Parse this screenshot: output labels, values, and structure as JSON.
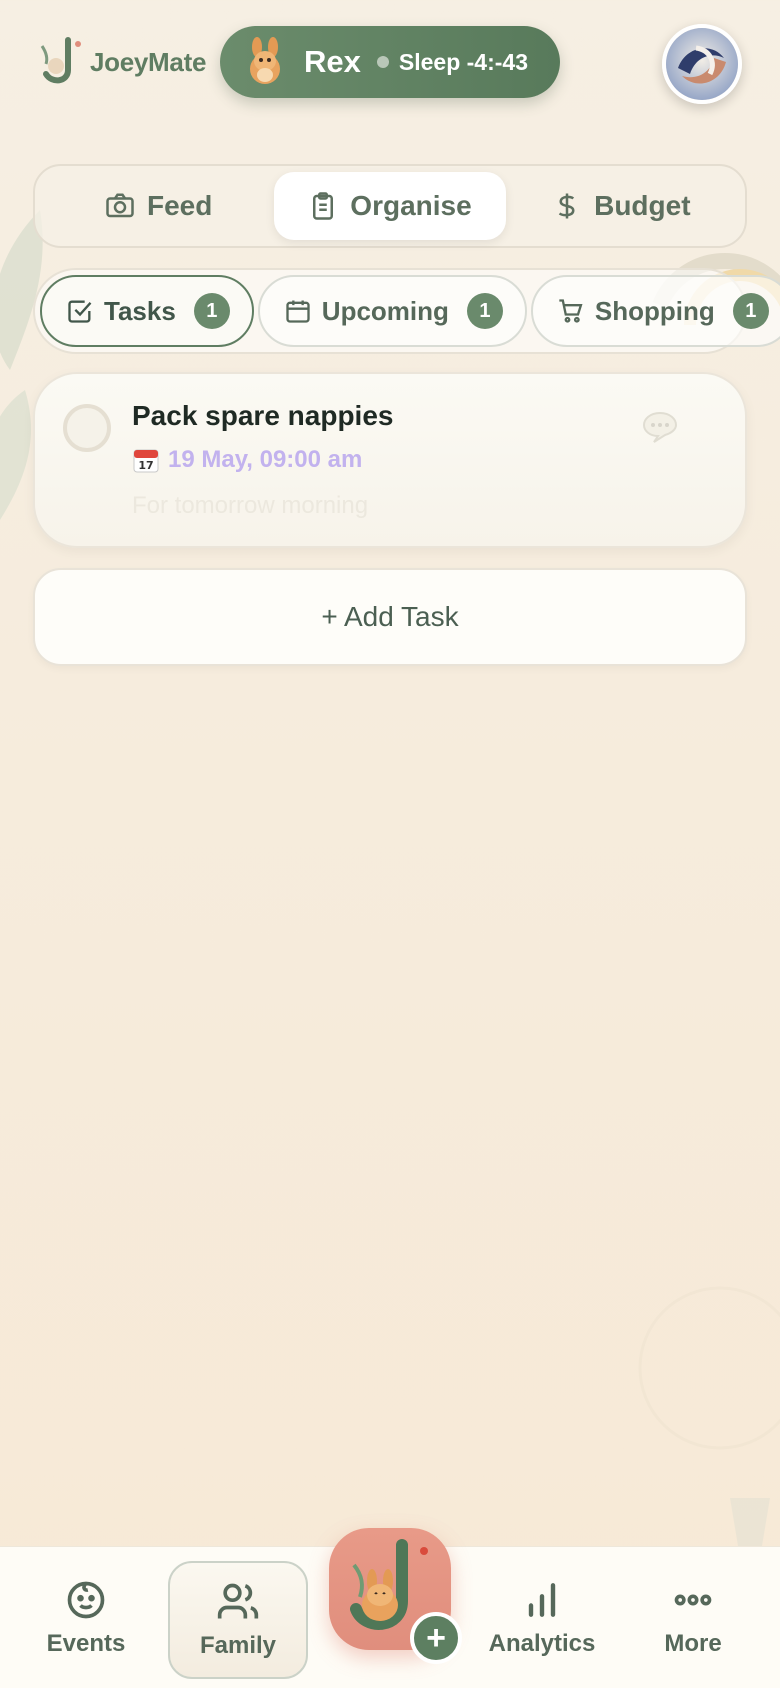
{
  "app": {
    "name": "JoeyMate"
  },
  "baby": {
    "name": "Rex",
    "status": "Sleep -4:-43"
  },
  "main_tabs": [
    {
      "label": "Feed",
      "icon": "camera-icon"
    },
    {
      "label": "Organise",
      "icon": "clipboard-icon",
      "active": true
    },
    {
      "label": "Budget",
      "icon": "dollar-icon"
    }
  ],
  "sub_tabs": [
    {
      "label": "Tasks",
      "count": "1",
      "icon": "checkbox-icon",
      "active": true
    },
    {
      "label": "Upcoming",
      "count": "1",
      "icon": "calendar-icon"
    },
    {
      "label": "Shopping",
      "count": "1",
      "icon": "cart-icon"
    }
  ],
  "tasks": [
    {
      "title": "Pack spare nappies",
      "date": "19 May, 09:00 am",
      "note": "For tomorrow morning"
    }
  ],
  "add_task_label": "+ Add Task",
  "bottom_nav": [
    {
      "label": "Events",
      "icon": "baby-face-icon"
    },
    {
      "label": "Family",
      "icon": "users-icon",
      "active": true
    },
    {
      "label": "Analytics",
      "icon": "bar-chart-icon"
    },
    {
      "label": "More",
      "icon": "more-dots-icon"
    }
  ],
  "colors": {
    "primary": "#5f7d62",
    "accent": "#e08e7d",
    "date": "#c2b2ee"
  }
}
